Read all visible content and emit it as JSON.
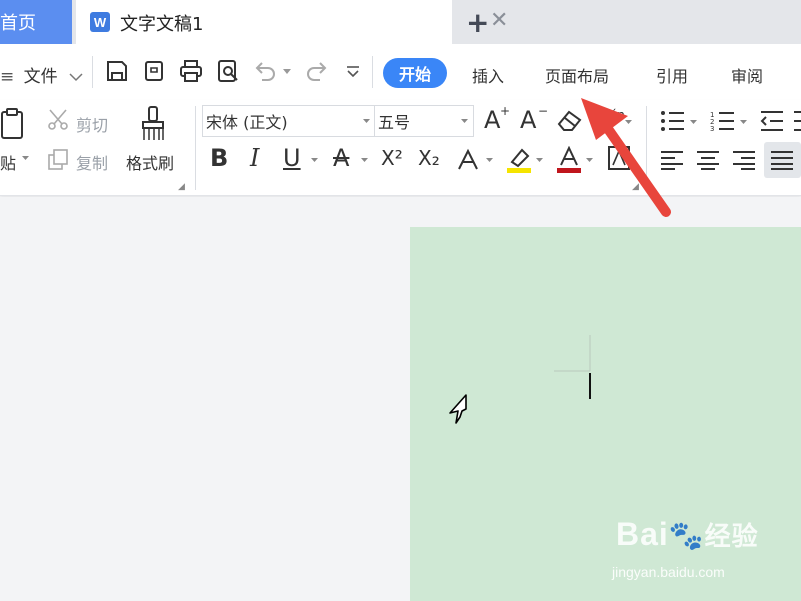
{
  "tabs": {
    "home_label": "首页",
    "doc_logo": "W",
    "doc_title": "文字文稿1",
    "close_symbol": "✕",
    "add_symbol": "+"
  },
  "menu": {
    "file_label": "文件",
    "start_label": "开始",
    "insert_label": "插入",
    "layout_label": "页面布局",
    "reference_label": "引用",
    "review_label": "审阅"
  },
  "ribbon": {
    "cut_label": "剪切",
    "copy_label": "复制",
    "paste_label": "贴",
    "format_painter_label": "格式刷",
    "font_name": "宋体 (正文)",
    "font_size": "五号",
    "bold": "B",
    "italic": "I",
    "underline": "U",
    "strike": "A",
    "superscript": "X²",
    "subscript": "X₂",
    "font_grow": "A",
    "font_shrink": "A",
    "phonetic": "wén"
  },
  "colors": {
    "accent": "#3a86f7",
    "home_tab": "#5b8ef0",
    "page": "#cfe8d4",
    "arrow": "#e8453c",
    "highlight": "#f5e400",
    "font_color": "#c0161d"
  },
  "icons": [
    "save-icon",
    "export-pdf-icon",
    "print-icon",
    "print-preview-icon",
    "undo-icon",
    "redo-icon",
    "more-icon",
    "scissors-icon",
    "copy-icon",
    "paste-icon",
    "brush-icon",
    "eraser-icon",
    "bullets-icon",
    "numbering-icon",
    "outdent-icon",
    "align-left-icon",
    "align-center-icon",
    "align-right-icon",
    "justify-icon"
  ],
  "watermark": {
    "brand": "Bai",
    "brand2": "经验",
    "url": "jingyan.baidu.com"
  }
}
